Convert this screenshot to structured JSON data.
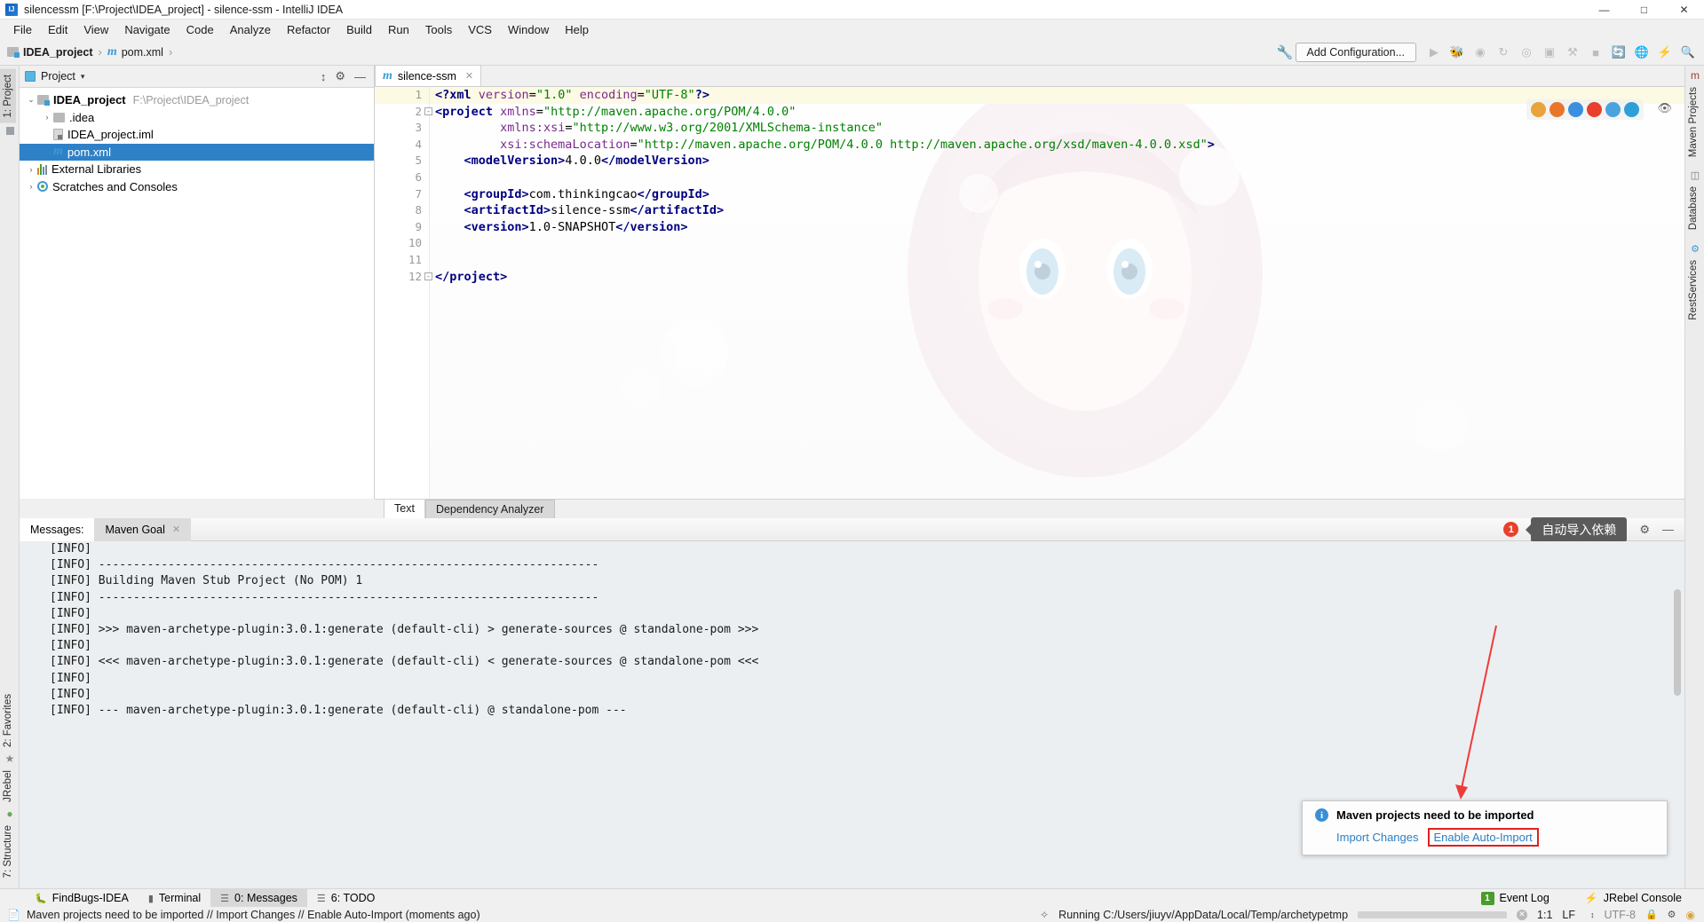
{
  "window": {
    "title": "silencessm [F:\\Project\\IDEA_project] - silence-ssm - IntelliJ IDEA",
    "logo_text": "IJ",
    "minimize": "—",
    "maximize": "□",
    "close": "✕"
  },
  "menubar": {
    "items": [
      {
        "label": "File"
      },
      {
        "label": "Edit"
      },
      {
        "label": "View"
      },
      {
        "label": "Navigate"
      },
      {
        "label": "Code"
      },
      {
        "label": "Analyze"
      },
      {
        "label": "Refactor"
      },
      {
        "label": "Build"
      },
      {
        "label": "Run"
      },
      {
        "label": "Tools"
      },
      {
        "label": "VCS"
      },
      {
        "label": "Window"
      },
      {
        "label": "Help"
      }
    ]
  },
  "navbar": {
    "breadcrumb": [
      {
        "label": "IDEA_project",
        "icon": "folder-icon"
      },
      {
        "label": "pom.xml",
        "icon": "maven-m-icon"
      }
    ],
    "separator": "›",
    "add_configuration": "Add Configuration...",
    "wrench_icon": "wrench-icon",
    "icons": [
      "run-icon",
      "debug-icon",
      "run-with-coverage-icon",
      "rerun-icon",
      "profile-icon",
      "attach-icon",
      "build-icon",
      "stop-icon",
      "vcs-update-icon",
      "translate-icon",
      "jrebel-icon",
      "search-icon"
    ]
  },
  "left_strip": {
    "top": [
      {
        "label": "1: Project",
        "active": true
      }
    ],
    "bottom": [
      {
        "label": "2: Favorites"
      },
      {
        "label": "JRebel"
      },
      {
        "label": "7: Structure"
      }
    ]
  },
  "right_strip": {
    "top": [
      {
        "label": "Maven Projects"
      },
      {
        "label": "Database"
      },
      {
        "label": "RestServices"
      }
    ]
  },
  "project_panel": {
    "title": "Project",
    "caret": "▾",
    "collapse_icon": "collapse-all-icon",
    "settings_icon": "gear-icon",
    "hide_icon": "hide-icon",
    "tree": [
      {
        "twisty": "⌄",
        "label": "IDEA_project",
        "bold": true,
        "path": "F:\\Project\\IDEA_project",
        "icon": "module-folder-icon",
        "indent": 0,
        "selected": false
      },
      {
        "twisty": "›",
        "label": ".idea",
        "bold": false,
        "path": "",
        "icon": "folder-icon",
        "indent": 1,
        "selected": false
      },
      {
        "twisty": "",
        "label": "IDEA_project.iml",
        "bold": false,
        "path": "",
        "icon": "iml-file-icon",
        "indent": 1,
        "selected": false
      },
      {
        "twisty": "",
        "label": "pom.xml",
        "bold": false,
        "path": "",
        "icon": "maven-m-icon",
        "indent": 1,
        "selected": true
      },
      {
        "twisty": "›",
        "label": "External Libraries",
        "bold": false,
        "path": "",
        "icon": "libraries-icon",
        "indent": 0,
        "selected": false
      },
      {
        "twisty": "›",
        "label": "Scratches and Consoles",
        "bold": false,
        "path": "",
        "icon": "scratches-icon",
        "indent": 0,
        "selected": false
      }
    ]
  },
  "editor": {
    "tab": {
      "label": "silence-ssm",
      "icon": "maven-m-icon",
      "close": "✕"
    },
    "eye_icon": "eye-icon",
    "browser_icons": [
      "chrome-icon",
      "firefox-icon",
      "safari-icon",
      "opera-icon",
      "ie-icon",
      "edge-icon"
    ],
    "browser_colors": [
      "#e8a33d",
      "#e8762a",
      "#3b8fe0",
      "#e8402a",
      "#4aa3df",
      "#2f9fd8"
    ],
    "lines": [
      {
        "n": "1",
        "highlight": true,
        "fold": "",
        "segs": [
          {
            "t": "<?xml ",
            "c": "pi"
          },
          {
            "t": "version",
            "c": "attr"
          },
          {
            "t": "=",
            "c": "eq"
          },
          {
            "t": "\"1.0\"",
            "c": "str"
          },
          {
            "t": " ",
            "c": "txt"
          },
          {
            "t": "encoding",
            "c": "attr"
          },
          {
            "t": "=",
            "c": "eq"
          },
          {
            "t": "\"UTF-8\"",
            "c": "str"
          },
          {
            "t": "?>",
            "c": "pi"
          }
        ]
      },
      {
        "n": "2",
        "highlight": false,
        "fold": "-",
        "segs": [
          {
            "t": "<project ",
            "c": "tag"
          },
          {
            "t": "xmlns",
            "c": "attr"
          },
          {
            "t": "=",
            "c": "eq"
          },
          {
            "t": "\"http://maven.apache.org/POM/4.0.0\"",
            "c": "str"
          }
        ]
      },
      {
        "n": "3",
        "highlight": false,
        "fold": "",
        "segs": [
          {
            "t": "         ",
            "c": "txt"
          },
          {
            "t": "xmlns:",
            "c": "attr"
          },
          {
            "t": "xsi",
            "c": "attr2"
          },
          {
            "t": "=",
            "c": "eq"
          },
          {
            "t": "\"http://www.w3.org/2001/XMLSchema-instance\"",
            "c": "str"
          }
        ]
      },
      {
        "n": "4",
        "highlight": false,
        "fold": "",
        "segs": [
          {
            "t": "         ",
            "c": "txt"
          },
          {
            "t": "xsi:",
            "c": "attr2"
          },
          {
            "t": "schemaLocation",
            "c": "attr"
          },
          {
            "t": "=",
            "c": "eq"
          },
          {
            "t": "\"http://maven.apache.org/POM/4.0.0 http://maven.apache.org/xsd/maven-4.0.0.xsd\"",
            "c": "str"
          },
          {
            "t": ">",
            "c": "tag"
          }
        ]
      },
      {
        "n": "5",
        "highlight": false,
        "fold": "",
        "segs": [
          {
            "t": "    ",
            "c": "txt"
          },
          {
            "t": "<modelVersion>",
            "c": "tag"
          },
          {
            "t": "4.0.0",
            "c": "txt"
          },
          {
            "t": "</modelVersion>",
            "c": "tag"
          }
        ]
      },
      {
        "n": "6",
        "highlight": false,
        "fold": "",
        "segs": []
      },
      {
        "n": "7",
        "highlight": false,
        "fold": "",
        "segs": [
          {
            "t": "    ",
            "c": "txt"
          },
          {
            "t": "<groupId>",
            "c": "tag"
          },
          {
            "t": "com.thinkingcao",
            "c": "txt"
          },
          {
            "t": "</groupId>",
            "c": "tag"
          }
        ]
      },
      {
        "n": "8",
        "highlight": false,
        "fold": "",
        "segs": [
          {
            "t": "    ",
            "c": "txt"
          },
          {
            "t": "<artifactId>",
            "c": "tag"
          },
          {
            "t": "silence-ssm",
            "c": "txt"
          },
          {
            "t": "</artifactId>",
            "c": "tag"
          }
        ]
      },
      {
        "n": "9",
        "highlight": false,
        "fold": "",
        "segs": [
          {
            "t": "    ",
            "c": "txt"
          },
          {
            "t": "<version>",
            "c": "tag"
          },
          {
            "t": "1.0-SNAPSHOT",
            "c": "txt"
          },
          {
            "t": "</version>",
            "c": "tag"
          }
        ]
      },
      {
        "n": "10",
        "highlight": false,
        "fold": "",
        "segs": []
      },
      {
        "n": "11",
        "highlight": false,
        "fold": "",
        "segs": []
      },
      {
        "n": "12",
        "highlight": false,
        "fold": "-",
        "segs": [
          {
            "t": "</project>",
            "c": "tag"
          }
        ]
      }
    ],
    "bottom_tabs": [
      {
        "label": "Text",
        "active": true
      },
      {
        "label": "Dependency Analyzer",
        "active": false
      }
    ]
  },
  "messages": {
    "label": "Messages:",
    "tab": {
      "label": "Maven Goal",
      "close": "✕"
    },
    "notification_count": "1",
    "tooltip": "自动导入依赖",
    "gear_icon": "gear-icon",
    "hide_icon": "hide-icon",
    "console_lines": [
      "[INFO]",
      "[INFO] ------------------------------------------------------------------------",
      "[INFO] Building Maven Stub Project (No POM) 1",
      "[INFO] ------------------------------------------------------------------------",
      "[INFO]",
      "[INFO] >>> maven-archetype-plugin:3.0.1:generate (default-cli) > generate-sources @ standalone-pom >>>",
      "[INFO]",
      "[INFO] <<< maven-archetype-plugin:3.0.1:generate (default-cli) < generate-sources @ standalone-pom <<<",
      "[INFO]",
      "[INFO]",
      "[INFO] --- maven-archetype-plugin:3.0.1:generate (default-cli) @ standalone-pom ---"
    ]
  },
  "popup": {
    "info_icon": "info-icon",
    "title": "Maven projects need to be imported",
    "import_changes": "Import Changes",
    "enable_auto_import": "Enable Auto-Import"
  },
  "bottom_tabs": {
    "items": [
      {
        "label": "FindBugs-IDEA",
        "icon": "findbugs-icon",
        "active": false
      },
      {
        "label": "Terminal",
        "icon": "terminal-icon",
        "active": false
      },
      {
        "label": "0: Messages",
        "icon": "messages-icon",
        "active": true
      },
      {
        "label": "6: TODO",
        "icon": "todo-icon",
        "active": false
      }
    ],
    "right": [
      {
        "label": "Event Log",
        "badge": "1",
        "icon": "event-log-icon"
      },
      {
        "label": "JRebel Console",
        "badge": "",
        "icon": "jrebel-icon"
      }
    ]
  },
  "statusbar": {
    "message": "Maven projects need to be imported // Import Changes // Enable Auto-Import (moments ago)",
    "message_icon": "message-icon",
    "running_text": "Running C:/Users/jiuyv/AppData/Local/Temp/archetypetmp",
    "running_icon": "spinner-icon",
    "stop_icon": "stop-icon",
    "caret_position": "1:1",
    "line_separator": "LF",
    "encoding": "UTF-8",
    "lock_icon": "lock-icon",
    "inspections_icon": "inspections-icon",
    "browser_icon": "chrome-icon",
    "progress_percent": 100
  },
  "colors": {
    "accent": "#2f81c7",
    "selection": "#2f81c7",
    "link": "#2b7fc4",
    "error_red": "#e8402a",
    "highlight_red": "#e02020",
    "tooltip_bg": "#5b5b5b",
    "string_green": "#008000",
    "tag_blue": "#000080",
    "attr_purple": "#7a2a8c"
  }
}
